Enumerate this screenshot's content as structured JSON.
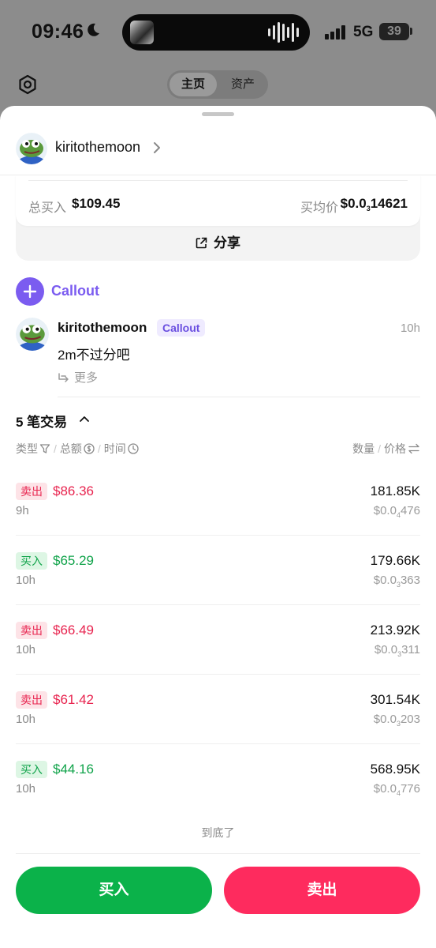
{
  "status_bar": {
    "time": "09:46",
    "network": "5G",
    "battery": "39"
  },
  "background": {
    "tabs": [
      "主页",
      "资产"
    ],
    "active_tab": "主页"
  },
  "header": {
    "username": "kiritothemoon"
  },
  "position": {
    "total_buy_label": "总买入",
    "total_buy_value": "$109.45",
    "avg_price_label": "买均价",
    "avg_price_prefix": "$0.0",
    "avg_price_zeros": "3",
    "avg_price_digits": "14621",
    "share_label": "分享"
  },
  "callout": {
    "label": "Callout"
  },
  "post": {
    "author": "kiritothemoon",
    "badge": "Callout",
    "time": "10h",
    "text": "2m不过分吧",
    "more_label": "更多"
  },
  "transactions": {
    "title": "5 笔交易",
    "columns": {
      "type": "类型",
      "total": "总额",
      "time": "时间",
      "quantity": "数量",
      "price": "价格"
    },
    "rows": [
      {
        "type": "卖出",
        "kind": "sell",
        "amount": "$86.36",
        "time": "9h",
        "quantity": "181.85K",
        "price_prefix": "$0.0",
        "price_zeros": "4",
        "price_digits": "476"
      },
      {
        "type": "买入",
        "kind": "buy",
        "amount": "$65.29",
        "time": "10h",
        "quantity": "179.66K",
        "price_prefix": "$0.0",
        "price_zeros": "3",
        "price_digits": "363"
      },
      {
        "type": "卖出",
        "kind": "sell",
        "amount": "$66.49",
        "time": "10h",
        "quantity": "213.92K",
        "price_prefix": "$0.0",
        "price_zeros": "3",
        "price_digits": "311"
      },
      {
        "type": "卖出",
        "kind": "sell",
        "amount": "$61.42",
        "time": "10h",
        "quantity": "301.54K",
        "price_prefix": "$0.0",
        "price_zeros": "3",
        "price_digits": "203"
      },
      {
        "type": "买入",
        "kind": "buy",
        "amount": "$44.16",
        "time": "10h",
        "quantity": "568.95K",
        "price_prefix": "$0.0",
        "price_zeros": "4",
        "price_digits": "776"
      }
    ],
    "end_label": "到底了"
  },
  "actions": {
    "buy_label": "买入",
    "sell_label": "卖出"
  },
  "colors": {
    "buy": "#0bb24a",
    "sell": "#fe2b5e",
    "accent": "#7b5cf0"
  },
  "icons": [
    "moon-icon",
    "signal-icon",
    "gear-icon",
    "chevron-right-icon",
    "share-icon",
    "plus-icon",
    "reply-icon",
    "caret-up-icon",
    "filter-icon",
    "dollar-circle-icon",
    "clock-icon",
    "swap-icon"
  ]
}
